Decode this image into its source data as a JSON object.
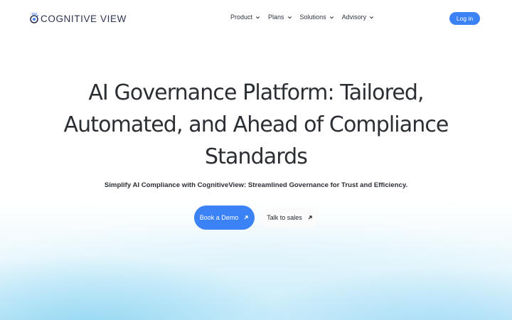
{
  "header": {
    "logo_text": "COGNITIVE VIEW",
    "nav": [
      {
        "label": "Product"
      },
      {
        "label": "Plans"
      },
      {
        "label": "Solutions"
      },
      {
        "label": "Advisory"
      }
    ],
    "login_label": "Log in"
  },
  "hero": {
    "title": "AI Governance Platform: Tailored, Automated, and Ahead of Compliance Standards",
    "subtitle": "Simplify AI Compliance with CognitiveView: Streamlined Governance for Trust and Efficiency.",
    "primary_cta": "Book a Demo",
    "secondary_cta": "Talk to sales"
  },
  "colors": {
    "accent": "#3b82f6",
    "text": "#2b2e33",
    "glow": "#8fd3f0"
  },
  "icons": {
    "logo": "brain-logo-icon",
    "nav_chevron": "chevron-down-icon",
    "cta_arrow": "arrow-up-right-icon"
  }
}
